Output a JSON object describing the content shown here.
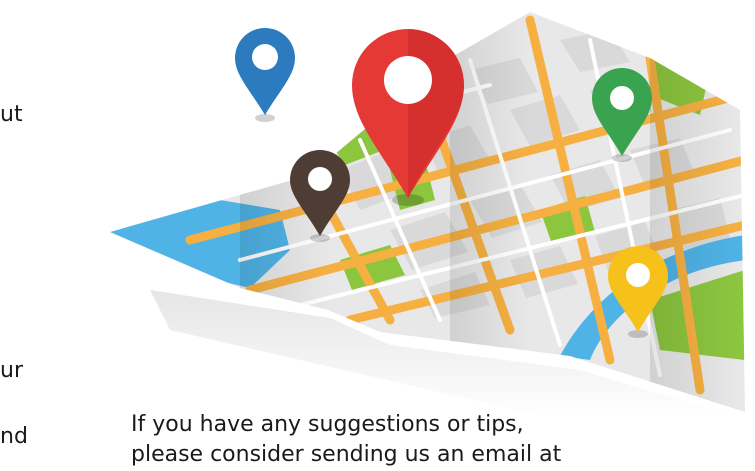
{
  "left_column": {
    "fragment_1": "ut",
    "fragment_2": "ur",
    "fragment_3": "nd"
  },
  "map_illustration": {
    "pin_colors": {
      "red": "#e53935",
      "blue": "#2c7bbf",
      "green": "#3aa350",
      "brown": "#4e3d34",
      "yellow": "#f7c11b"
    },
    "water_color": "#4fb3e6",
    "park_color": "#8cc63f",
    "road_color": "#f6b042"
  },
  "suggestion": {
    "line_1": "If you have any suggestions or tips,",
    "line_2": "please consider sending us an email at"
  }
}
